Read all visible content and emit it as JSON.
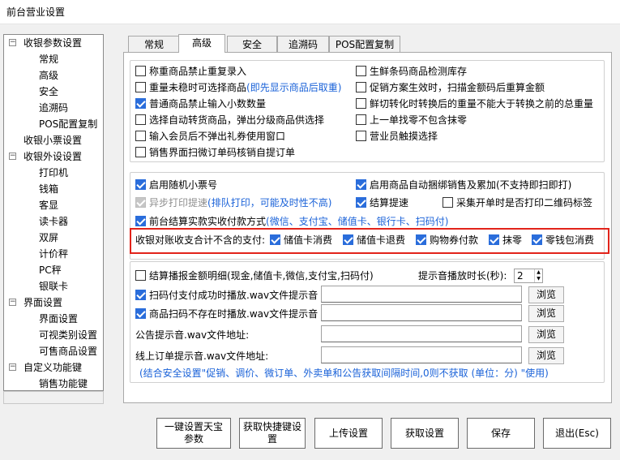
{
  "window": {
    "title": "前台营业设置"
  },
  "tree": {
    "nodes": [
      {
        "label": "收银参数设置",
        "level": 0,
        "toggle": "⊟"
      },
      {
        "label": "常规",
        "level": 1
      },
      {
        "label": "高级",
        "level": 1
      },
      {
        "label": "安全",
        "level": 1
      },
      {
        "label": "追溯码",
        "level": 1
      },
      {
        "label": "POS配置复制",
        "level": 1
      },
      {
        "label": "收银小票设置",
        "level": 0
      },
      {
        "label": "收银外设设置",
        "level": 0,
        "toggle": "⊟"
      },
      {
        "label": "打印机",
        "level": 1
      },
      {
        "label": "钱箱",
        "level": 1
      },
      {
        "label": "客显",
        "level": 1
      },
      {
        "label": "读卡器",
        "level": 1
      },
      {
        "label": "双屏",
        "level": 1
      },
      {
        "label": "计价秤",
        "level": 1
      },
      {
        "label": "PC秤",
        "level": 1
      },
      {
        "label": "银联卡",
        "level": 1
      },
      {
        "label": "界面设置",
        "level": 0,
        "toggle": "⊟"
      },
      {
        "label": "界面设置",
        "level": 1
      },
      {
        "label": "可视类别设置",
        "level": 1
      },
      {
        "label": "可售商品设置",
        "level": 1
      },
      {
        "label": "自定义功能键",
        "level": 0,
        "toggle": "⊟"
      },
      {
        "label": "销售功能键",
        "level": 1
      }
    ]
  },
  "tabs": [
    "常规",
    "高级",
    "安全",
    "追溯码",
    "POS配置复制"
  ],
  "active_tab": "高级",
  "group1": {
    "left": [
      {
        "label": "称重商品禁止重复录入",
        "checked": false
      },
      {
        "label": "重量未稳时可选择商品",
        "note": "(即先显示商品后取重)",
        "checked": false
      },
      {
        "label": "普通商品禁止输入小数数量",
        "checked": true
      },
      {
        "label": "选择自动转货商品，弹出分级商品供选择",
        "checked": false
      },
      {
        "label": "输入会员后不弹出礼券使用窗口",
        "checked": false
      },
      {
        "label": "销售界面扫微订单码核销自提订单",
        "checked": false
      }
    ],
    "right": [
      {
        "label": "生鲜条码商品检测库存",
        "checked": false
      },
      {
        "label": "促销方案生效时，扫描金额码后重算金额",
        "checked": false
      },
      {
        "label": "鲜切转化时转换后的重量不能大于转换之前的总重量",
        "checked": false
      },
      {
        "label": "上一单找零不包含抹零",
        "checked": false
      },
      {
        "label": "营业员触摸选择",
        "checked": false
      }
    ]
  },
  "group2": {
    "random_ticket": "启用随机小票号",
    "auto_bundle": "启用商品自动捆绑销售及累加(不支持即扫即打)",
    "async_print": "异步打印提速",
    "async_print_note": "(排队打印，可能及时性不高)",
    "checkout_speed": "结算提速",
    "collect_qr": "采集开单时是否打印二维码标签",
    "actual_payment": "前台结算实款实收付款方式",
    "actual_payment_note": "(微信、支付宝、储值卡、银行卡、扫码付)"
  },
  "exclusion": {
    "label": "收银对账收支合计不含的支付:",
    "items": [
      "储值卡消费",
      "储值卡退费",
      "购物券付款",
      "抹零",
      "零钱包消费"
    ]
  },
  "group3": {
    "detail_broadcast": "结算播报金额明细(现金,储值卡,微信,支付宝,扫码付)",
    "duration_label": "提示音播放时长(秒):",
    "duration_value": "2",
    "scan_success": "扫码付支付成功时播放.wav文件提示音",
    "scan_missing": "商品扫码不存在时播放.wav文件提示音",
    "notice_label": "公告提示音.wav文件地址:",
    "online_label": "线上订单提示音.wav文件地址:",
    "browse_label": "浏览",
    "note": "(结合安全设置\"促销、调价、微订单、外卖单和公告获取间隔时间,0则不获取 (单位：分) \"使用)"
  },
  "buttons": {
    "one_key": "一键设置天宝参数",
    "fetch_shortcut": "获取快捷键设置",
    "upload": "上传设置",
    "fetch": "获取设置",
    "save": "保存",
    "exit": "退出(Esc)"
  },
  "colors": {
    "accent": "#2a6ddb",
    "highlight": "#e2231a",
    "note_blue": "#1a62d8"
  }
}
